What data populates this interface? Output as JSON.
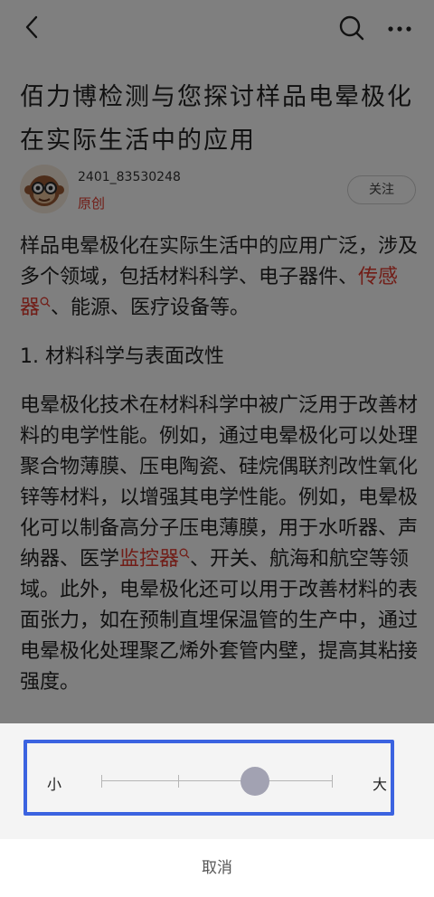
{
  "topbar": {
    "back_icon": "back-arrow-icon",
    "search_icon": "search-icon",
    "more_icon": "more-dots-icon"
  },
  "article": {
    "title": "佰力博检测与您探讨样品电晕极化在实际生活中的应用",
    "author_name": "2401_83530248",
    "author_tag": "原创",
    "follow_label": "关注",
    "p1_a": "样品电晕极化在实际生活中的应用广泛，涉及多个领域，包括材料科学、电子器件、",
    "p1_link": "传感器",
    "p1_b": "、能源、医疗设备等。",
    "section_heading": "1. 材料科学与表面改性",
    "p2_a": "电晕极化技术在材料科学中被广泛用于改善材料的电学性能。例如，通过电晕极化可以处理聚合物薄膜、压电陶瓷、硅烷偶联剂改性氧化锌等材料，以增强其电学性能。例如，电晕极化可以制备高分子压电薄膜，用于水听器、声纳器、医学",
    "p2_link": "监控器",
    "p2_b": "、开关、航海和航空等领域。此外，电晕极化还可以用于改善材料的表面张力，如在预制直埋保温管的生产中，通过电晕极化处理聚乙烯外套管内壁，提高其粘接强度。"
  },
  "font_size_sheet": {
    "small_label": "小",
    "large_label": "大",
    "level_index": 2,
    "level_count": 4,
    "cancel_label": "取消",
    "highlight_color": "#3b63e0"
  },
  "colors": {
    "link": "#e33b2e",
    "overlay": "rgba(0,0,0,0.5)"
  }
}
